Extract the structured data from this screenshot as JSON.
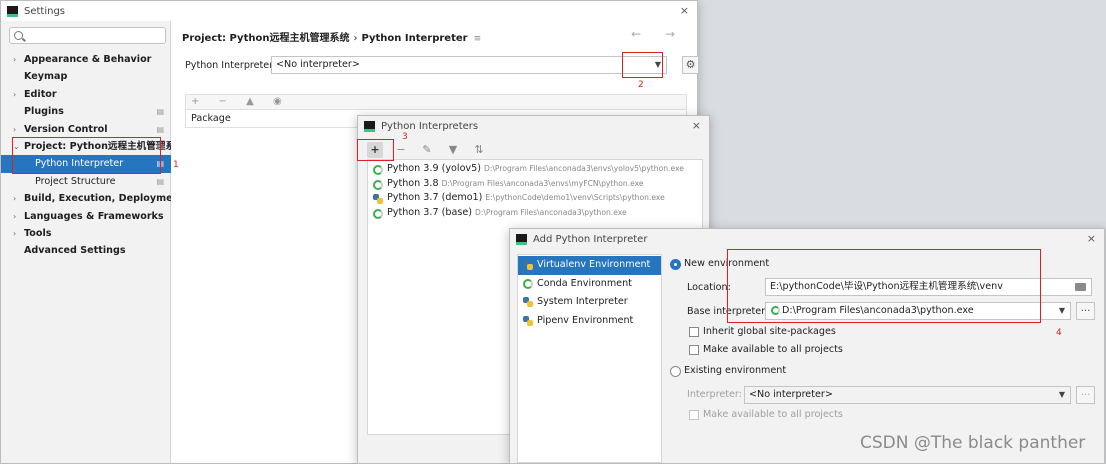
{
  "settings": {
    "title": "Settings",
    "search_placeholder": "",
    "nav": [
      {
        "label": "Appearance & Behavior",
        "arrow": "›",
        "cfg": ""
      },
      {
        "label": "Keymap",
        "arrow": "",
        "cfg": ""
      },
      {
        "label": "Editor",
        "arrow": "›",
        "cfg": ""
      },
      {
        "label": "Plugins",
        "arrow": "",
        "cfg": "▤"
      },
      {
        "label": "Version Control",
        "arrow": "›",
        "cfg": "▤"
      },
      {
        "label": "Project: Python远程主机管理系统",
        "arrow": "⌄",
        "cfg": "▤"
      },
      {
        "label": "Python Interpreter",
        "arrow": "",
        "cfg": "▤"
      },
      {
        "label": "Project Structure",
        "arrow": "",
        "cfg": "▤"
      },
      {
        "label": "Build, Execution, Deployment",
        "arrow": "›",
        "cfg": ""
      },
      {
        "label": "Languages & Frameworks",
        "arrow": "›",
        "cfg": ""
      },
      {
        "label": "Tools",
        "arrow": "›",
        "cfg": ""
      },
      {
        "label": "Advanced Settings",
        "arrow": "",
        "cfg": ""
      }
    ],
    "breadcrumb": {
      "project": "Project: Python远程主机管理系统",
      "sep": "›",
      "page": "Python Interpreter",
      "menu_icon": "≡"
    },
    "nav_arrows": "← →",
    "interpreter_label": "Python Interpreter:",
    "interpreter_value": "<No interpreter>",
    "dropdown_icon": "▼",
    "gear_icon": "⚙",
    "pkg_toolbar": "+ − ▲ ◉",
    "pkg_header": "Package"
  },
  "annotations": [
    "1",
    "2",
    "3",
    "4"
  ],
  "interpreters_dialog": {
    "title": "Python Interpreters",
    "close": "×",
    "toolbar": [
      "+",
      "−",
      "✎",
      "▼",
      "⇅"
    ],
    "items": [
      {
        "name": "Python 3.9 (yolov5)",
        "path": "D:\\Program Files\\anconada3\\envs\\yolov5\\python.exe",
        "icon": "ring-icon"
      },
      {
        "name": "Python 3.8",
        "path": "D:\\Program Files\\anconada3\\envs\\myFCN\\python.exe",
        "icon": "ring-icon"
      },
      {
        "name": "Python 3.7 (demo1)",
        "path": "E:\\pythonCode\\demo1\\venv\\Scripts\\python.exe",
        "icon": "python-icon"
      },
      {
        "name": "Python 3.7 (base)",
        "path": "D:\\Program Files\\anconada3\\python.exe",
        "icon": "ring-icon"
      }
    ]
  },
  "add_dialog": {
    "title": "Add Python Interpreter",
    "close": "×",
    "envs": [
      {
        "label": "Virtualenv Environment",
        "icon": "python-icon"
      },
      {
        "label": "Conda Environment",
        "icon": "ring-icon"
      },
      {
        "label": "System Interpreter",
        "icon": "python-icon"
      },
      {
        "label": "Pipenv Environment",
        "icon": "python-icon"
      }
    ],
    "new_env_label": "New environment",
    "location_label": "Location:",
    "location_value": "E:\\pythonCode\\毕设\\Python远程主机管理系统\\venv",
    "base_label": "Base interpreter:",
    "base_value": "D:\\Program Files\\anconada3\\python.exe",
    "browse": "...",
    "inherit_label": "Inherit global site-packages",
    "make_available_label": "Make available to all projects",
    "existing_env_label": "Existing environment",
    "interpreter_label": "Interpreter:",
    "interpreter_value": "<No interpreter>",
    "make_available_existing_label": "Make available to all projects"
  },
  "watermark": "CSDN @The black panther"
}
